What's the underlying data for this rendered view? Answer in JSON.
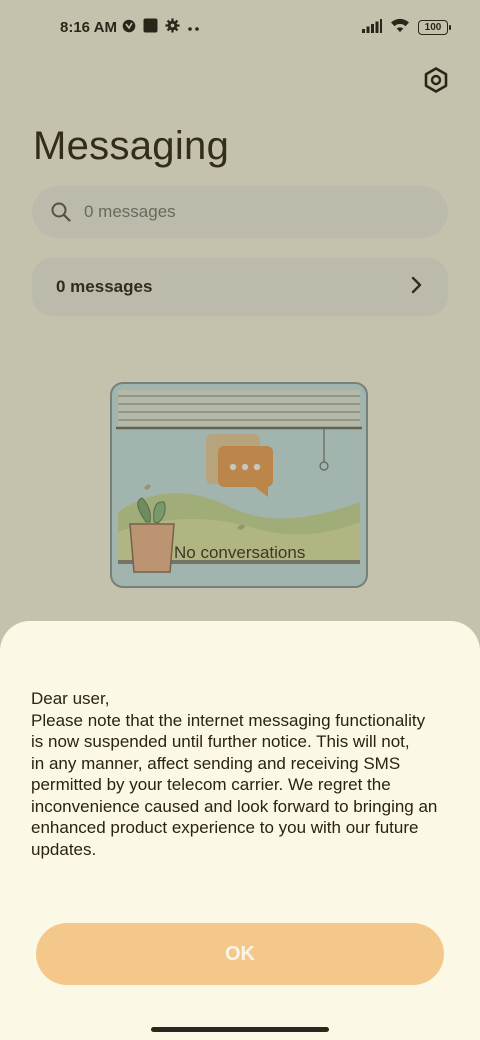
{
  "status_bar": {
    "time": "8:16 AM",
    "battery": "100",
    "left_icons": [
      "vpn-icon",
      "app-square-icon",
      "settings-gear-icon",
      "more-dots-icon"
    ],
    "right_icons": [
      "signal-icon",
      "wifi-icon",
      "battery-icon"
    ]
  },
  "header": {
    "title": "Messaging",
    "settings_icon": "hexagon-settings-icon"
  },
  "search": {
    "placeholder": "0 messages"
  },
  "summary": {
    "label": "0 messages"
  },
  "empty_state": {
    "label": "No conversations"
  },
  "dialog": {
    "message_lines": [
      "Dear user,",
      "Please note that the internet messaging functionality",
      "is now suspended until further notice. This will not,",
      "in any manner, affect sending and receiving SMS",
      "permitted by your telecom carrier. We regret the",
      "inconvenience caused and look forward to bringing an",
      "enhanced product experience to you with our future",
      "updates."
    ],
    "ok_label": "OK"
  },
  "colors": {
    "background": "#fbf8e6",
    "accent": "#f4c88a",
    "scrim": "#46422880"
  }
}
